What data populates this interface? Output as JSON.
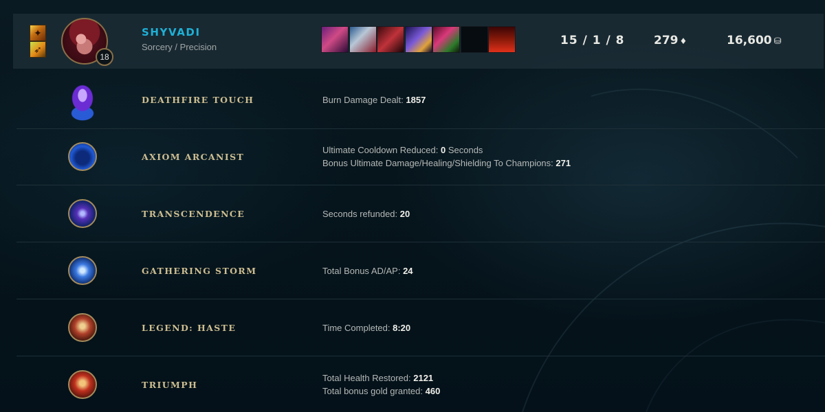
{
  "player": {
    "champion_name": "SHYVADI",
    "rune_paths": "Sorcery / Precision",
    "level": "18",
    "kda": "15 / 1 / 8",
    "cs": "279",
    "gold": "16,600",
    "summoner_spells": [
      "flash-spell-icon",
      "ghost-spell-icon"
    ],
    "items": [
      "item-1",
      "item-2",
      "item-3",
      "item-4",
      "item-5",
      "",
      "trinket"
    ]
  },
  "runes": [
    {
      "name": "DEATHFIRE TOUCH",
      "icon": "deathfire-touch-icon",
      "stats": [
        {
          "label": "Burn Damage Dealt: ",
          "value": "1857",
          "suffix": ""
        }
      ]
    },
    {
      "name": "AXIOM ARCANIST",
      "icon": "axiom-arcanist-icon",
      "stats": [
        {
          "label": "Ultimate Cooldown Reduced: ",
          "value": "0",
          "suffix": " Seconds"
        },
        {
          "label": "Bonus Ultimate Damage/Healing/Shielding To Champions: ",
          "value": "271",
          "suffix": ""
        }
      ]
    },
    {
      "name": "TRANSCENDENCE",
      "icon": "transcendence-icon",
      "stats": [
        {
          "label": "Seconds refunded: ",
          "value": "20",
          "suffix": ""
        }
      ]
    },
    {
      "name": "GATHERING STORM",
      "icon": "gathering-storm-icon",
      "stats": [
        {
          "label": "Total Bonus AD/AP: ",
          "value": "24",
          "suffix": ""
        }
      ]
    },
    {
      "name": "LEGEND: HASTE",
      "icon": "legend-haste-icon",
      "stats": [
        {
          "label": "Time Completed: ",
          "value": "8:20",
          "suffix": ""
        }
      ]
    },
    {
      "name": "TRIUMPH",
      "icon": "triumph-icon",
      "stats": [
        {
          "label": "Total Health Restored: ",
          "value": "2121",
          "suffix": ""
        },
        {
          "label": "Total bonus gold granted: ",
          "value": "460",
          "suffix": ""
        }
      ]
    }
  ]
}
